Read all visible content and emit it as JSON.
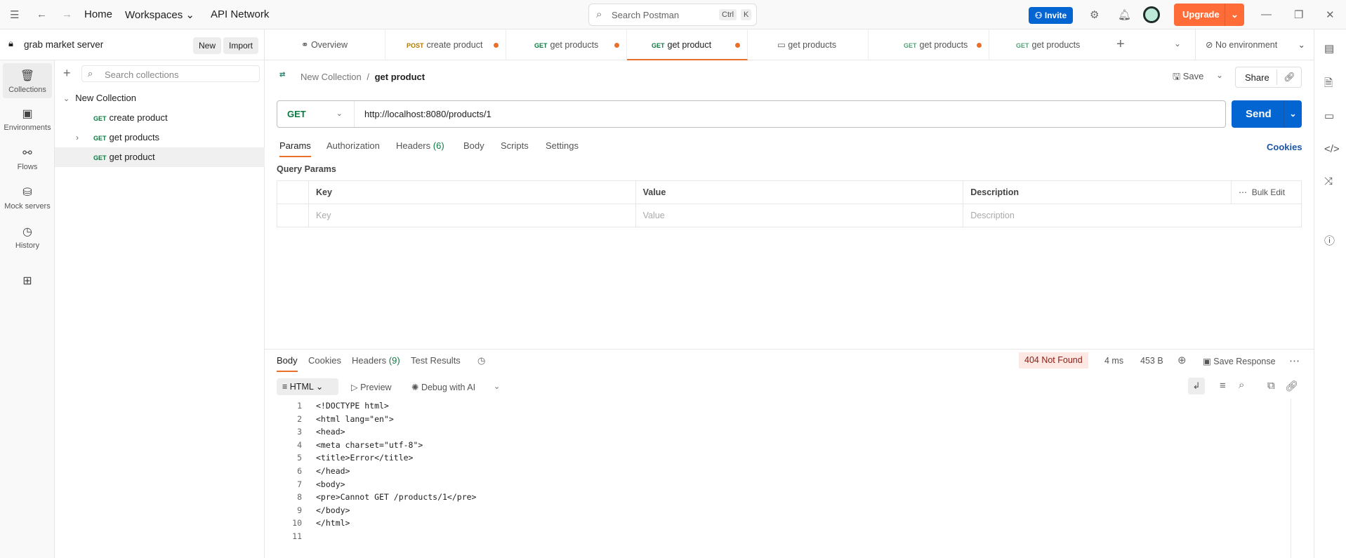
{
  "topbar": {
    "home": "Home",
    "workspaces": "Workspaces",
    "api_network": "API Network",
    "search_placeholder": "Search Postman",
    "kbd1": "Ctrl",
    "kbd2": "K",
    "invite": "Invite",
    "upgrade": "Upgrade"
  },
  "sidebar": {
    "workspace": "grab market server",
    "new": "New",
    "import": "Import",
    "search_placeholder": "Search collections",
    "rail": [
      {
        "label": "Collections"
      },
      {
        "label": "Environments"
      },
      {
        "label": "Flows"
      },
      {
        "label": "Mock servers"
      },
      {
        "label": "History"
      }
    ],
    "collection": "New Collection",
    "items": [
      {
        "method": "GET",
        "name": "create product"
      },
      {
        "method": "GET",
        "name": "get products"
      },
      {
        "method": "GET",
        "name": "get product"
      }
    ]
  },
  "tabs": [
    {
      "method": "",
      "name": "Overview",
      "dot": false
    },
    {
      "method": "POST",
      "name": "create product",
      "dot": true
    },
    {
      "method": "GET",
      "name": "get products",
      "dot": true
    },
    {
      "method": "GET",
      "name": "get product",
      "dot": true,
      "active": true
    },
    {
      "method": "",
      "name": "get products",
      "dot": false
    },
    {
      "method": "GET",
      "name": "get products",
      "dot": true
    },
    {
      "method": "GET",
      "name": "get products",
      "dot": false
    }
  ],
  "environment": "No environment",
  "request": {
    "breadcrumb_parent": "New Collection",
    "breadcrumb_sep": "/",
    "name": "get product",
    "save": "Save",
    "share": "Share",
    "method": "GET",
    "url": "http://localhost:8080/products/1",
    "send": "Send",
    "tabs": [
      "Params",
      "Authorization",
      "Headers",
      "Body",
      "Scripts",
      "Settings"
    ],
    "headers_count": "(6)",
    "cookies": "Cookies",
    "query_params_title": "Query Params",
    "columns": [
      "Key",
      "Value",
      "Description"
    ],
    "bulk_edit": "Bulk Edit",
    "placeholders": [
      "Key",
      "Value",
      "Description"
    ]
  },
  "response": {
    "tabs": [
      "Body",
      "Cookies",
      "Headers",
      "Test Results"
    ],
    "headers_count": "(9)",
    "status": "404 Not Found",
    "time": "4 ms",
    "size": "453 B",
    "save_response": "Save Response",
    "format": "HTML",
    "preview": "Preview",
    "debug": "Debug with AI",
    "lines": [
      "<!DOCTYPE html>",
      "<html lang=\"en\">",
      "<head>",
      "<meta charset=\"utf-8\">",
      "<title>Error</title>",
      "</head>",
      "<body>",
      "<pre>Cannot GET /products/1</pre>",
      "</body>",
      "</html>",
      ""
    ]
  },
  "colors": {
    "accent": "#ff6c37",
    "primary": "#0265d2",
    "get": "#0b7a42",
    "post": "#ad7a03"
  }
}
